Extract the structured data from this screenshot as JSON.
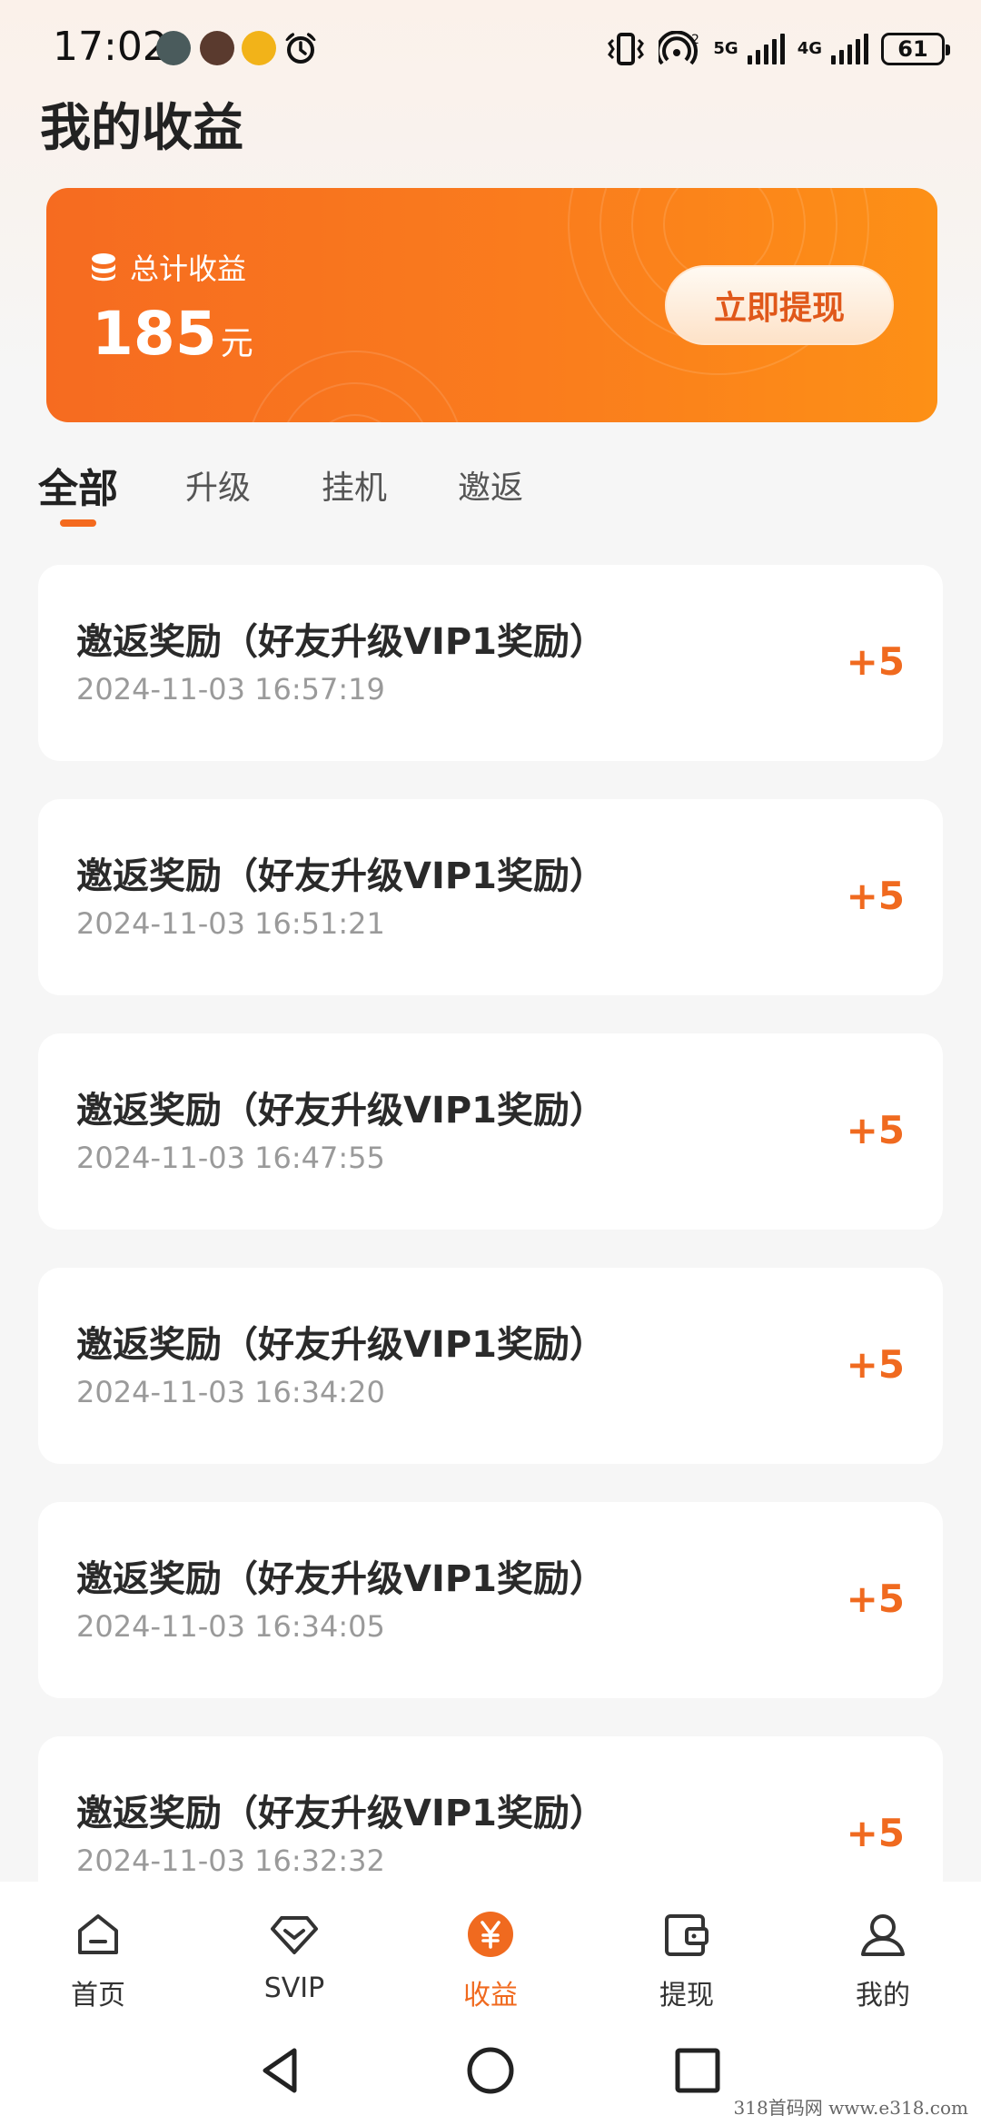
{
  "status_bar": {
    "time": "17:02",
    "network_5g": "5G",
    "network_4g": "4G",
    "battery": "61"
  },
  "page": {
    "title": "我的收益"
  },
  "earnings_card": {
    "label": "总计收益",
    "amount": "185",
    "unit": "元",
    "withdraw_button": "立即提现",
    "gradient_start": "#f66b20",
    "gradient_end": "#fd9016"
  },
  "tabs": [
    {
      "label": "全部",
      "active": true
    },
    {
      "label": "升级",
      "active": false
    },
    {
      "label": "挂机",
      "active": false
    },
    {
      "label": "邀返",
      "active": false
    }
  ],
  "records": [
    {
      "title": "邀返奖励（好友升级VIP1奖励）",
      "time": "2024-11-03 16:57:19",
      "amount": "+5"
    },
    {
      "title": "邀返奖励（好友升级VIP1奖励）",
      "time": "2024-11-03 16:51:21",
      "amount": "+5"
    },
    {
      "title": "邀返奖励（好友升级VIP1奖励）",
      "time": "2024-11-03 16:47:55",
      "amount": "+5"
    },
    {
      "title": "邀返奖励（好友升级VIP1奖励）",
      "time": "2024-11-03 16:34:20",
      "amount": "+5"
    },
    {
      "title": "邀返奖励（好友升级VIP1奖励）",
      "time": "2024-11-03 16:34:05",
      "amount": "+5"
    },
    {
      "title": "邀返奖励（好友升级VIP1奖励）",
      "time": "2024-11-03 16:32:32",
      "amount": "+5"
    }
  ],
  "bottom_nav": [
    {
      "label": "首页",
      "icon": "home-icon",
      "active": false
    },
    {
      "label": "SVIP",
      "icon": "diamond-icon",
      "active": false
    },
    {
      "label": "收益",
      "icon": "yen-icon",
      "active": true
    },
    {
      "label": "提现",
      "icon": "wallet-icon",
      "active": false
    },
    {
      "label": "我的",
      "icon": "user-icon",
      "active": false
    }
  ],
  "watermark": "318首码网  www.e318.com",
  "colors": {
    "accent": "#f06a1f",
    "page_bg": "#f6f6f6"
  }
}
